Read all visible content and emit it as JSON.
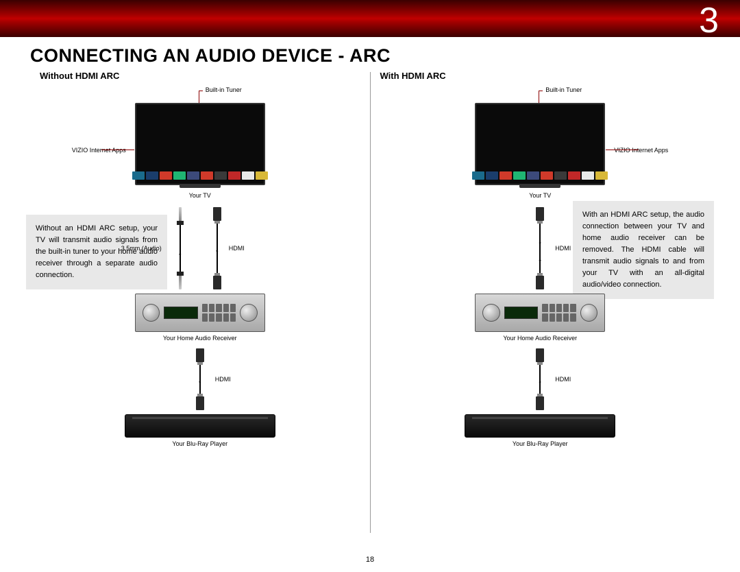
{
  "chapter_number": "3",
  "page_title": "CONNECTING AN AUDIO DEVICE - ARC",
  "page_number": "18",
  "left": {
    "heading": "Without HDMI ARC",
    "info": "Without an HDMI ARC setup, your TV will transmit audio signals from the built-in tuner to your home audio receiver through a separate audio connection.",
    "tuner_label": "Built-in Tuner",
    "apps_label": "VIZIO Internet Apps",
    "tv_label": "Your TV",
    "cable_audio_label": "3.5mm (Audio)",
    "cable_hdmi_label": "HDMI",
    "receiver_label": "Your Home Audio Receiver",
    "cable_hdmi2_label": "HDMI",
    "bluray_label": "Your Blu-Ray Player",
    "app_colors": [
      "#1a6b8c",
      "#1a3d6b",
      "#d03a2a",
      "#20b573",
      "#3c4a7a",
      "#d03a2a",
      "#3a3a3a",
      "#c02828",
      "#e8e8e8",
      "#d8b838"
    ]
  },
  "right": {
    "heading": "With HDMI ARC",
    "info": "With an HDMI ARC setup, the audio connection between your TV and home audio receiver can be removed. The HDMI cable will transmit audio signals to and from your TV with an all-digital audio/video connection.",
    "tuner_label": "Built-in Tuner",
    "apps_label": "VIZIO Internet Apps",
    "tv_label": "Your TV",
    "cable_hdmi_label": "HDMI",
    "receiver_label": "Your Home Audio Receiver",
    "cable_hdmi2_label": "HDMI",
    "bluray_label": "Your Blu-Ray Player",
    "app_colors": [
      "#1a6b8c",
      "#1a3d6b",
      "#d03a2a",
      "#20b573",
      "#3c4a7a",
      "#d03a2a",
      "#3a3a3a",
      "#c02828",
      "#e8e8e8",
      "#d8b838"
    ]
  }
}
